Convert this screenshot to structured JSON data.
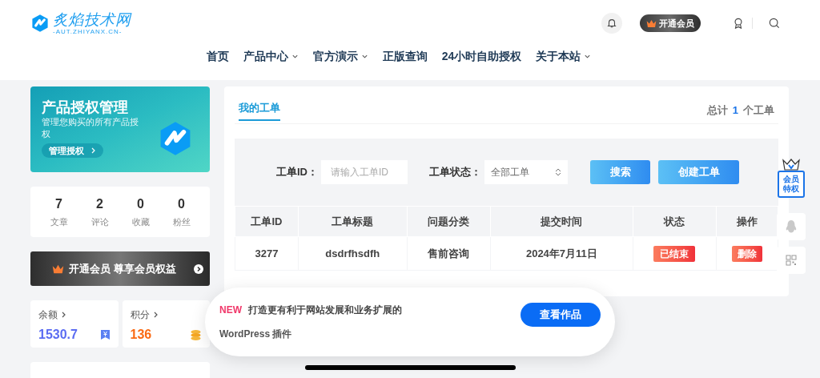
{
  "header": {
    "logo": {
      "name": "炙焰技术网",
      "domain": "-AUT.ZHIYANX.CN-"
    },
    "vip_button": "开通会员",
    "nav": [
      {
        "label": "首页",
        "dropdown": false
      },
      {
        "label": "产品中心",
        "dropdown": true
      },
      {
        "label": "官方演示",
        "dropdown": true
      },
      {
        "label": "正版查询",
        "dropdown": false
      },
      {
        "label": "24小时自助授权",
        "dropdown": false
      },
      {
        "label": "关于本站",
        "dropdown": true
      }
    ]
  },
  "sidebar": {
    "banner": {
      "title": "产品授权管理",
      "subtitle": "管理您购买的所有产品授权",
      "button": "管理授权"
    },
    "stats": [
      {
        "value": "7",
        "label": "文章"
      },
      {
        "value": "2",
        "label": "评论"
      },
      {
        "value": "0",
        "label": "收藏"
      },
      {
        "value": "0",
        "label": "粉丝"
      }
    ],
    "vip_bar": "开通会员 尊享会员权益",
    "wallet": [
      {
        "kind": "balance",
        "label": "余额",
        "value": "1530.7"
      },
      {
        "kind": "points",
        "label": "积分",
        "value": "136"
      }
    ]
  },
  "main": {
    "tabs": [
      {
        "label": "我的工单",
        "selected": true
      }
    ],
    "total": {
      "prefix": "总计",
      "count": "1",
      "suffix": "个工单"
    },
    "filter": {
      "id_label": "工单ID：",
      "id_placeholder": "请输入工单ID",
      "status_label": "工单状态：",
      "status_value": "全部工单",
      "buttons": [
        "搜索",
        "创建工单"
      ]
    },
    "table": {
      "columns": [
        "工单ID",
        "工单标题",
        "问题分类",
        "提交时间",
        "状态",
        "操作"
      ],
      "rows": [
        {
          "id": "3277",
          "title": "dsdrfhsdfh",
          "category": "售前咨询",
          "time": "2024年7月11日",
          "status": "已结束",
          "action": "删除"
        }
      ]
    }
  },
  "float_bar": {
    "vip_badge": "会员特权"
  },
  "promo": {
    "badge": "NEW",
    "text": "打造更有利于网站发展和业务扩展的",
    "text2": "WordPress 插件",
    "button": "查看作品"
  }
}
